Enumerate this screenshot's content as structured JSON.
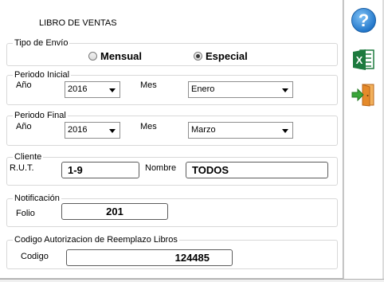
{
  "window": {
    "title": "LIBRO DE VENTAS"
  },
  "envio": {
    "legend": "Tipo de Envío",
    "options": [
      {
        "label": "Mensual",
        "checked": false
      },
      {
        "label": "Especial",
        "checked": true
      }
    ]
  },
  "periodo_inicial": {
    "legend": "Periodo Inicial",
    "year_label": "Año",
    "year_value": "2016",
    "month_label": "Mes",
    "month_value": "Enero"
  },
  "periodo_final": {
    "legend": "Periodo Final",
    "year_label": "Año",
    "year_value": "2016",
    "month_label": "Mes",
    "month_value": "Marzo"
  },
  "cliente": {
    "legend": "Cliente",
    "rut_label": "R.U.T.",
    "rut_value": "1-9",
    "nombre_label": "Nombre",
    "nombre_value": "TODOS"
  },
  "notificacion": {
    "legend": "Notificación",
    "folio_label": "Folio",
    "folio_value": "201"
  },
  "codigo_reemplazo": {
    "legend": "Codigo Autorizacion de Reemplazo Libros",
    "codigo_label": "Codigo",
    "codigo_value": "124485"
  },
  "toolbar": {
    "help_icon": "help-icon",
    "excel_icon": "excel-icon",
    "exit_icon": "exit-door-icon",
    "colors": {
      "help": "#1e73c8",
      "excel": "#1d7a3e",
      "exit": "#e58a2a"
    }
  }
}
